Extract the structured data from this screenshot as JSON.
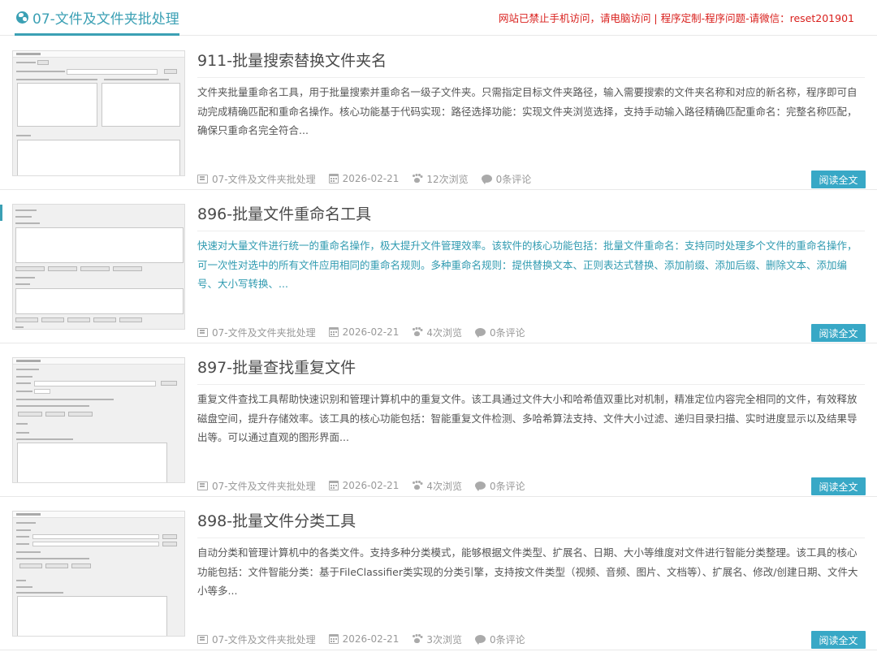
{
  "header": {
    "title": "07-文件及文件夹批处理",
    "notice": "网站已禁止手机访问，请电脑访问 | 程序定制-程序问题-请微信：reset201901"
  },
  "read_more_label": "阅读全文",
  "posts": [
    {
      "title": "911-批量搜索替换文件夹名",
      "excerpt": "文件夹批量重命名工具，用于批量搜索并重命名一级子文件夹。只需指定目标文件夹路径，输入需要搜索的文件夹名称和对应的新名称，程序即可自动完成精确匹配和重命名操作。核心功能基于代码实现：路径选择功能：实现文件夹浏览选择，支持手动输入路径精确匹配重命名：完整名称匹配，确保只重命名完全符合...",
      "category": "07-文件及文件夹批处理",
      "date": "2026-02-21",
      "views": "12次浏览",
      "comments": "0条评论"
    },
    {
      "title": "896-批量文件重命名工具",
      "excerpt": "快速对大量文件进行统一的重命名操作，极大提升文件管理效率。该软件的核心功能包括：批量文件重命名：支持同时处理多个文件的重命名操作，可一次性对选中的所有文件应用相同的重命名规则。多种重命名规则：提供替换文本、正则表达式替换、添加前缀、添加后缀、删除文本、添加编号、大小写转换、...",
      "category": "07-文件及文件夹批处理",
      "date": "2026-02-21",
      "views": "4次浏览",
      "comments": "0条评论"
    },
    {
      "title": "897-批量查找重复文件",
      "excerpt": "重复文件查找工具帮助快速识别和管理计算机中的重复文件。该工具通过文件大小和哈希值双重比对机制，精准定位内容完全相同的文件，有效释放磁盘空间，提升存储效率。该工具的核心功能包括：智能重复文件检测、多哈希算法支持、文件大小过滤、递归目录扫描、实时进度显示以及结果导出等。可以通过直观的图形界面...",
      "category": "07-文件及文件夹批处理",
      "date": "2026-02-21",
      "views": "4次浏览",
      "comments": "0条评论"
    },
    {
      "title": "898-批量文件分类工具",
      "excerpt": "自动分类和管理计算机中的各类文件。支持多种分类模式，能够根据文件类型、扩展名、日期、大小等维度对文件进行智能分类整理。该工具的核心功能包括：文件智能分类：基于FileClassifier类实现的分类引擎，支持按文件类型（视频、音频、图片、文档等）、扩展名、修改/创建日期、文件大小等多...",
      "category": "07-文件及文件夹批处理",
      "date": "2026-02-21",
      "views": "3次浏览",
      "comments": "0条评论"
    }
  ]
}
